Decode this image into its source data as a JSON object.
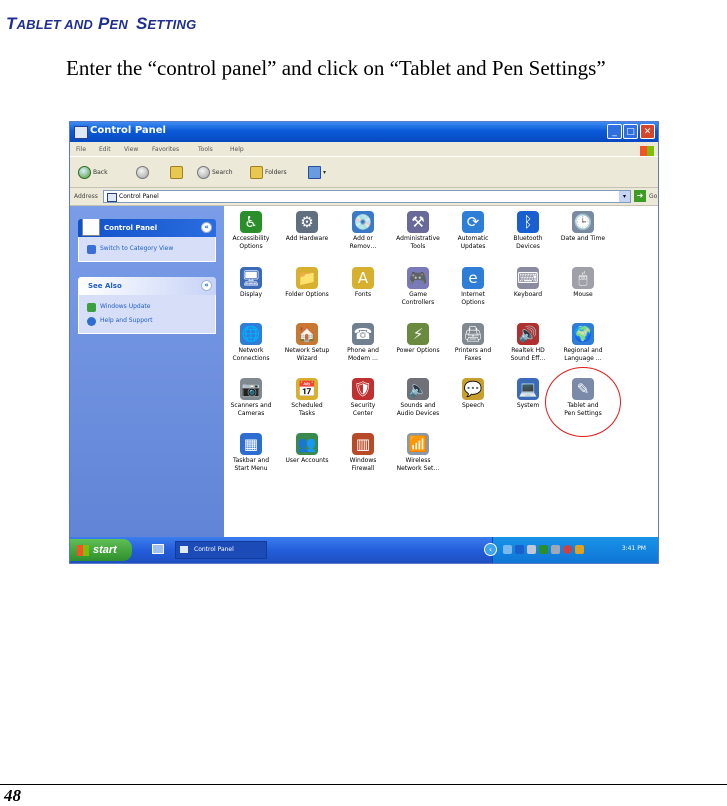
{
  "heading": {
    "part1_big": "T",
    "part1_small": "ABLET AND",
    "part2_big": "P",
    "part2_small": "EN",
    "part3_big": "S",
    "part3_small": "ETTING"
  },
  "instruction": "Enter the “control panel” and click on “Tablet and Pen Settings”",
  "screenshot": {
    "window_title": "Control Panel",
    "menu": [
      "File",
      "Edit",
      "View",
      "Favorites",
      "Tools",
      "Help"
    ],
    "toolbar": {
      "back": "Back",
      "search": "Search",
      "folders": "Folders"
    },
    "address": {
      "label": "Address",
      "value": "Control Panel",
      "go": "Go"
    },
    "left_panels": {
      "control_panel": {
        "title": "Control Panel",
        "items": [
          "Switch to Category View"
        ]
      },
      "see_also": {
        "title": "See Also",
        "items": [
          "Windows Update",
          "Help and Support"
        ]
      }
    },
    "icons": [
      {
        "line1": "Accessibility",
        "line2": "Options",
        "color": "#2a8f2a",
        "glyph": "♿"
      },
      {
        "line1": "Add Hardware",
        "line2": "",
        "color": "#607080",
        "glyph": "⚙"
      },
      {
        "line1": "Add or",
        "line2": "Remov…",
        "color": "#3a78c8",
        "glyph": "💿"
      },
      {
        "line1": "Administrative",
        "line2": "Tools",
        "color": "#6a6a9a",
        "glyph": "⚒"
      },
      {
        "line1": "Automatic",
        "line2": "Updates",
        "color": "#2e7ed8",
        "glyph": "⟳"
      },
      {
        "line1": "Bluetooth",
        "line2": "Devices",
        "color": "#1a5fd0",
        "glyph": "ᛒ"
      },
      {
        "line1": "Date and Time",
        "line2": "",
        "color": "#7a8aa0",
        "glyph": "🕒"
      },
      {
        "line1": "Display",
        "line2": "",
        "color": "#3a6ab8",
        "glyph": "🖥"
      },
      {
        "line1": "Folder Options",
        "line2": "",
        "color": "#d8b030",
        "glyph": "📁"
      },
      {
        "line1": "Fonts",
        "line2": "",
        "color": "#d8b030",
        "glyph": "A"
      },
      {
        "line1": "Game",
        "line2": "Controllers",
        "color": "#7a7ab8",
        "glyph": "🎮"
      },
      {
        "line1": "Internet",
        "line2": "Options",
        "color": "#2e7ed8",
        "glyph": "e"
      },
      {
        "line1": "Keyboard",
        "line2": "",
        "color": "#8a8aa0",
        "glyph": "⌨"
      },
      {
        "line1": "Mouse",
        "line2": "",
        "color": "#a0a0a8",
        "glyph": "🖱"
      },
      {
        "line1": "Network",
        "line2": "Connections",
        "color": "#2e7ed8",
        "glyph": "🌐"
      },
      {
        "line1": "Network Setup",
        "line2": "Wizard",
        "color": "#c87830",
        "glyph": "🏠"
      },
      {
        "line1": "Phone and",
        "line2": "Modem …",
        "color": "#708090",
        "glyph": "☎"
      },
      {
        "line1": "Power Options",
        "line2": "",
        "color": "#6a8a40",
        "glyph": "⚡"
      },
      {
        "line1": "Printers and",
        "line2": "Faxes",
        "color": "#808890",
        "glyph": "🖨"
      },
      {
        "line1": "Realtek HD",
        "line2": "Sound Eff…",
        "color": "#b03030",
        "glyph": "🔊"
      },
      {
        "line1": "Regional and",
        "line2": "Language …",
        "color": "#2e7ed8",
        "glyph": "🌍"
      },
      {
        "line1": "Scanners and",
        "line2": "Cameras",
        "color": "#808890",
        "glyph": "📷"
      },
      {
        "line1": "Scheduled",
        "line2": "Tasks",
        "color": "#d8b030",
        "glyph": "📅"
      },
      {
        "line1": "Security",
        "line2": "Center",
        "color": "#c03030",
        "glyph": "🛡"
      },
      {
        "line1": "Sounds and",
        "line2": "Audio Devices",
        "color": "#707078",
        "glyph": "🔈"
      },
      {
        "line1": "Speech",
        "line2": "",
        "color": "#c8a030",
        "glyph": "💬"
      },
      {
        "line1": "System",
        "line2": "",
        "color": "#3a6ab8",
        "glyph": "💻"
      },
      {
        "line1": "Tablet and",
        "line2": "Pen Settings",
        "color": "#7a8aa8",
        "glyph": "✎"
      },
      {
        "line1": "Taskbar and",
        "line2": "Start Menu",
        "color": "#2e6ed0",
        "glyph": "▦"
      },
      {
        "line1": "User Accounts",
        "line2": "",
        "color": "#3a8a50",
        "glyph": "👥"
      },
      {
        "line1": "Windows",
        "line2": "Firewall",
        "color": "#b84a28",
        "glyph": "▥"
      },
      {
        "line1": "Wireless",
        "line2": "Network Set…",
        "color": "#8a98a8",
        "glyph": "📶"
      }
    ],
    "taskbar": {
      "start": "start",
      "app": "Control Panel",
      "clock": "3:41 PM"
    }
  },
  "page_number": "48"
}
